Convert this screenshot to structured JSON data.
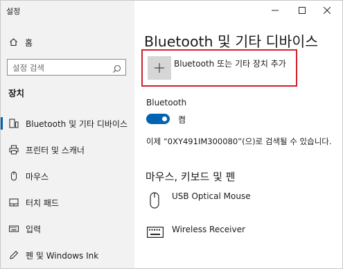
{
  "window": {
    "title": "설정"
  },
  "sidebar": {
    "home_label": "홈",
    "search_placeholder": "설정 검색",
    "section_label": "장치",
    "items": [
      {
        "label": "Bluetooth 및 기타 디바이스",
        "icon": "bluetooth-devices-icon",
        "active": true
      },
      {
        "label": "프린터 및 스캐너",
        "icon": "printer-icon"
      },
      {
        "label": "마우스",
        "icon": "mouse-icon"
      },
      {
        "label": "터치 패드",
        "icon": "touchpad-icon"
      },
      {
        "label": "입력",
        "icon": "keyboard-icon"
      },
      {
        "label": "펜 및 Windows Ink",
        "icon": "pen-icon"
      }
    ]
  },
  "main": {
    "title": "Bluetooth 및 기타 디바이스",
    "add_device_label": "Bluetooth 또는 기타 장치 추가",
    "bluetooth": {
      "label": "Bluetooth",
      "toggle_state": "켬",
      "discoverable_text": "이제 “0XY491IM300080”(으)로 검색될 수 있습니다."
    },
    "section_title": "마우스, 키보드 및 펜",
    "devices": [
      {
        "name": "USB Optical Mouse",
        "icon": "mouse-icon"
      },
      {
        "name": "Wireless Receiver",
        "icon": "keyboard-icon"
      }
    ]
  },
  "colors": {
    "accent": "#0063b1",
    "highlight": "#d0202a",
    "sidebar_bg": "#f2f2f2"
  }
}
